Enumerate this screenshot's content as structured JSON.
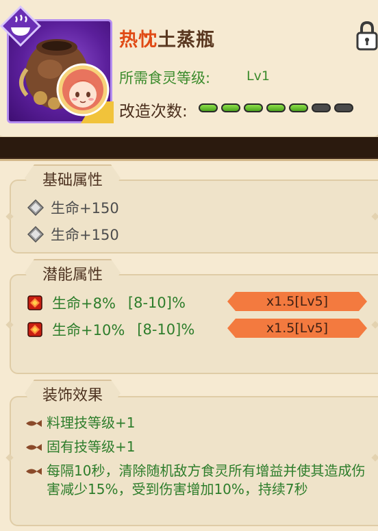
{
  "header": {
    "title_hot": "热忱",
    "title_rest": "土蒸瓶",
    "required_level_label": "所需食灵等级:",
    "required_level_value": "Lv1",
    "modify_label": "改造次数:",
    "modify_filled": 5,
    "modify_total": 7
  },
  "sections": {
    "base": {
      "title": "基础属性",
      "rows": [
        "生命+150",
        "生命+150"
      ]
    },
    "potential": {
      "title": "潜能属性",
      "rows": [
        {
          "stat": "生命+8%",
          "range": "[8-10]%",
          "mult": "x1.5[Lv5]"
        },
        {
          "stat": "生命+10%",
          "range": "[8-10]%",
          "mult": "x1.5[Lv5]"
        }
      ]
    },
    "decoration": {
      "title": "装饰效果",
      "items": [
        "料理技等级+1",
        "固有技等级+1",
        "每隔10秒，清除随机敌方食灵所有增益并使其造成伤害减少15%，受到伤害增加10%，持续7秒"
      ]
    }
  },
  "colors": {
    "accent_orange": "#f37a3f",
    "green_text": "#2d7d2b",
    "title_hot": "#e04a15"
  },
  "icons": {
    "category": "steam-bowl-icon",
    "lock": "lock-icon",
    "base_gem": "diamond-gem-icon",
    "potential_gem": "red-square-gem-icon",
    "bullet": "fish-bullet-icon"
  }
}
